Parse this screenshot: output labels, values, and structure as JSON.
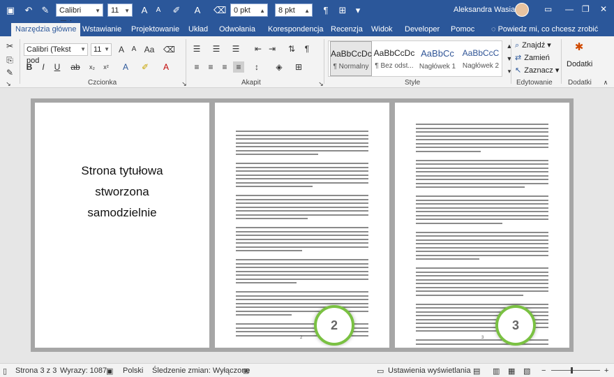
{
  "qat": {
    "font_name": "Calibri (Tekst",
    "font_size": "11",
    "spacing_before": "0 pkt",
    "spacing_after": "8 pkt",
    "user_name": "Aleksandra Wasiak"
  },
  "tabs": [
    {
      "label": "Narzędzia główne",
      "active": true
    },
    {
      "label": "Wstawianie"
    },
    {
      "label": "Projektowanie"
    },
    {
      "label": "Układ"
    },
    {
      "label": "Odwołania"
    },
    {
      "label": "Korespondencja"
    },
    {
      "label": "Recenzja"
    },
    {
      "label": "Widok"
    },
    {
      "label": "Developer"
    },
    {
      "label": "Pomoc"
    }
  ],
  "tell_me": "Powiedz mi, co chcesz zrobić",
  "ribbon": {
    "font_name": "Calibri (Tekst pod",
    "font_size": "11",
    "groups": {
      "font": "Czcionka",
      "paragraph": "Akapit",
      "styles": "Style",
      "editing": "Edytowanie",
      "addins": "Dodatki"
    },
    "styles": [
      {
        "preview": "AaBbCcDc",
        "name": "¶ Normalny",
        "selected": true
      },
      {
        "preview": "AaBbCcDc",
        "name": "¶ Bez odst..."
      },
      {
        "preview": "AaBbCc",
        "name": "Nagłówek 1"
      },
      {
        "preview": "AaBbCcC",
        "name": "Nagłówek 2"
      }
    ],
    "editing": {
      "find": "Znajdź",
      "replace": "Zamień",
      "select": "Zaznacz"
    },
    "addins_label": "Dodatki"
  },
  "document": {
    "title_page_text": [
      "Strona tytułowa",
      "stworzona",
      "samodzielnie"
    ],
    "page_numbers": [
      "2",
      "3"
    ],
    "callouts": [
      "2",
      "3"
    ]
  },
  "status": {
    "page": "Strona 3 z 3",
    "words": "Wyrazy: 1087",
    "language": "Polski",
    "track_changes": "Śledzenie zmian: Wyłączone",
    "display_settings": "Ustawienia wyświetlania"
  },
  "colors": {
    "accent": "#2b579a",
    "callout_ring": "#7ac142"
  }
}
